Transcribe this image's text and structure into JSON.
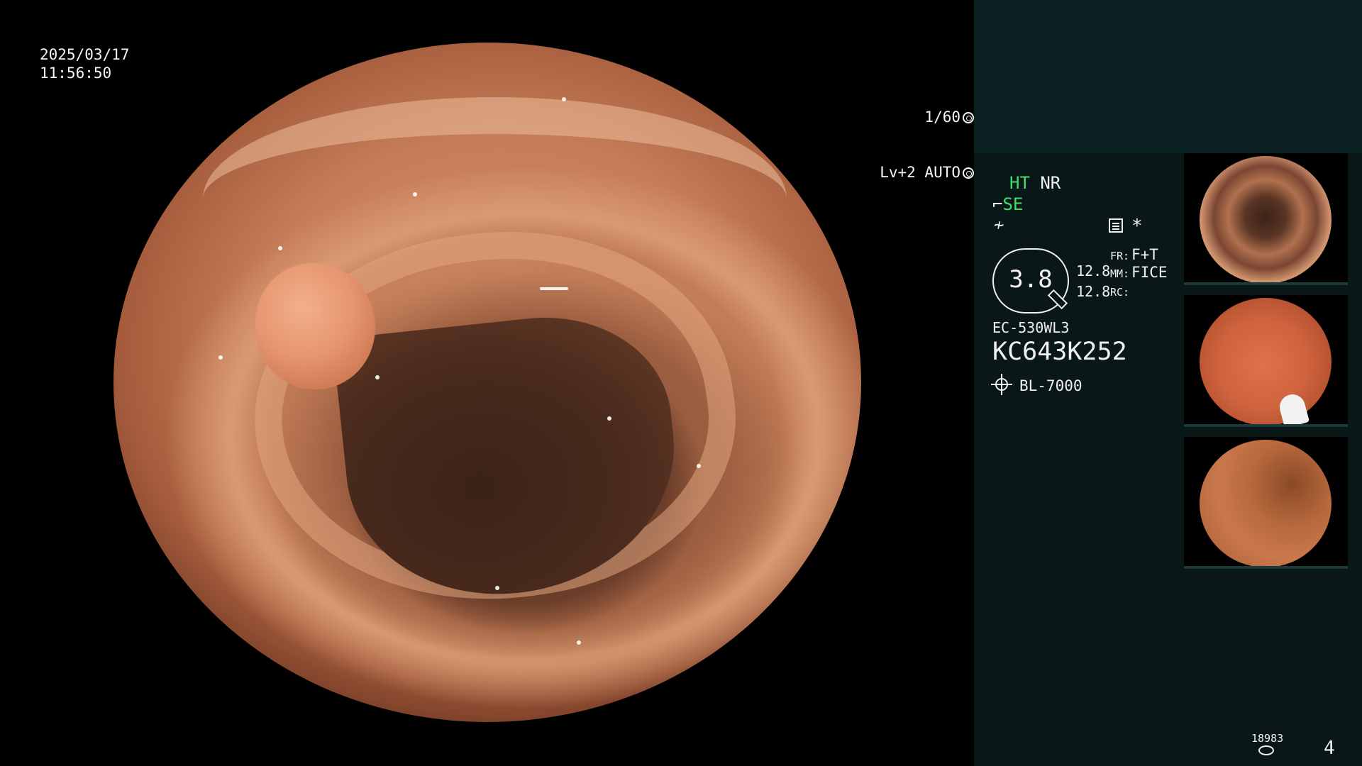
{
  "overlay": {
    "date": "2025/03/17",
    "time": "11:56:50",
    "shutter": "1/60",
    "level": "Lv+2",
    "exposure_mode": "AUTO"
  },
  "panel": {
    "mode_ht": "HT",
    "mode_nr": "NR",
    "mode_se": "SE",
    "mode_f": "≁",
    "asterisk": "*",
    "zoom_value": "3.8",
    "value_a": "12.8",
    "value_b": "12.8",
    "fr_label": "FR:",
    "fr_value": "F+T",
    "mm_label": "MM:",
    "mm_value": "FICE",
    "rc_label": "RC:",
    "scope_model": "EC-530WL3",
    "scope_serial": "KC643K252",
    "light_source": "BL-7000",
    "storage_count": "18983",
    "page_index": "4"
  },
  "icons": {
    "shutter_icon": "aperture-icon",
    "auto_icon": "auto-iris-icon",
    "memory_icon": "memory-icon",
    "light_icon": "light-source-icon",
    "storage_icon": "storage-icon"
  },
  "colors": {
    "accent_green": "#3ee06a",
    "panel_bg": "#0a1717",
    "panel_top": "#0b2121"
  }
}
